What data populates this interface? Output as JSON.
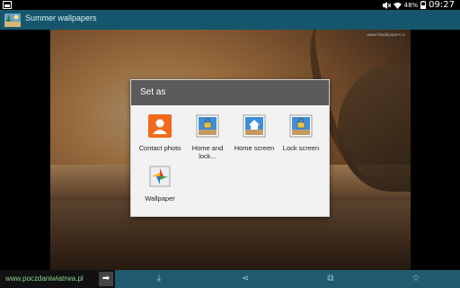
{
  "status_bar": {
    "battery": "48%",
    "time": "09:27"
  },
  "action_bar": {
    "title": "Summer wallpapers"
  },
  "dialog": {
    "title": "Set as",
    "options": [
      {
        "label": "Contact photo",
        "icon": "contact-icon"
      },
      {
        "label": "Home and lock...",
        "icon": "home-lock-icon"
      },
      {
        "label": "Home screen",
        "icon": "home-icon"
      },
      {
        "label": "Lock screen",
        "icon": "lock-icon"
      },
      {
        "label": "Wallpaper",
        "icon": "wallpaper-icon"
      }
    ]
  },
  "wallpaper": {
    "watermark": "www.hdwallpapers.in"
  },
  "bottom_bar": {
    "ad_text": "www.poczdaniwiatrwa.pl",
    "ad_arrow": "➡",
    "download": "⤓",
    "share": "⋖",
    "crop": "⧉",
    "favorite": "☆"
  }
}
